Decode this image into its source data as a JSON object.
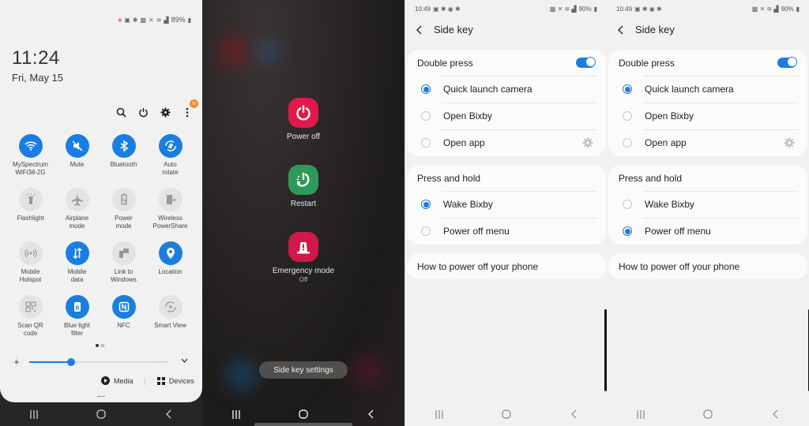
{
  "quick_panel": {
    "status": {
      "battery": "89%"
    },
    "clock": "11:24",
    "date": "Fri, May 15",
    "tools": [
      {
        "name": "search-icon"
      },
      {
        "name": "power-icon"
      },
      {
        "name": "settings-icon"
      },
      {
        "name": "more-icon",
        "badge": "N"
      }
    ],
    "tiles": [
      {
        "label": "MySpectrum\nWiFi38-2G",
        "icon": "wifi-icon",
        "on": true
      },
      {
        "label": "Mute",
        "icon": "mute-icon",
        "on": true
      },
      {
        "label": "Bluetooth",
        "icon": "bluetooth-icon",
        "on": true
      },
      {
        "label": "Auto\nrotate",
        "icon": "auto-rotate-icon",
        "on": true
      },
      {
        "label": "Flashlight",
        "icon": "flashlight-icon",
        "on": false
      },
      {
        "label": "Airplane\nmode",
        "icon": "airplane-icon",
        "on": false
      },
      {
        "label": "Power\nmode",
        "icon": "power-mode-icon",
        "on": false
      },
      {
        "label": "Wireless\nPowerShare",
        "icon": "wireless-powershare-icon",
        "on": false
      },
      {
        "label": "Mobile\nHotspot",
        "icon": "hotspot-icon",
        "on": false
      },
      {
        "label": "Mobile\ndata",
        "icon": "mobile-data-icon",
        "on": true
      },
      {
        "label": "Link to\nWindows",
        "icon": "link-to-windows-icon",
        "on": false
      },
      {
        "label": "Location",
        "icon": "location-icon",
        "on": true
      },
      {
        "label": "Scan QR\ncode",
        "icon": "qr-code-icon",
        "on": false
      },
      {
        "label": "Blue light\nfilter",
        "icon": "blue-light-icon",
        "on": true
      },
      {
        "label": "NFC",
        "icon": "nfc-icon",
        "on": true
      },
      {
        "label": "Smart View",
        "icon": "smart-view-icon",
        "on": false
      }
    ],
    "page_indicator": {
      "current": 1,
      "total": 2
    },
    "brightness_percent": 30,
    "media_label": "Media",
    "devices_label": "Devices"
  },
  "power_menu": {
    "items": [
      {
        "label": "Power off",
        "sub": "",
        "color": "#e0194a"
      },
      {
        "label": "Restart",
        "sub": "",
        "color": "#2e9a5a"
      },
      {
        "label": "Emergency mode",
        "sub": "Off",
        "color": "#d0184a"
      }
    ],
    "side_key_settings_label": "Side key settings"
  },
  "side_key_screens": [
    {
      "status": {
        "time": "10:49",
        "battery": "90%"
      },
      "title": "Side key",
      "double_press": {
        "label": "Double press",
        "enabled": true,
        "options": [
          "Quick launch camera",
          "Open Bixby",
          "Open app"
        ],
        "selected": 0
      },
      "press_and_hold": {
        "label": "Press and hold",
        "options": [
          "Wake Bixby",
          "Power off menu"
        ],
        "selected": 0
      },
      "how_to_label": "How to power off your phone"
    },
    {
      "status": {
        "time": "10:49",
        "battery": "90%"
      },
      "title": "Side key",
      "double_press": {
        "label": "Double press",
        "enabled": true,
        "options": [
          "Quick launch camera",
          "Open Bixby",
          "Open app"
        ],
        "selected": 0
      },
      "press_and_hold": {
        "label": "Press and hold",
        "options": [
          "Wake Bixby",
          "Power off menu"
        ],
        "selected": 1
      },
      "how_to_label": "How to power off your phone"
    }
  ],
  "colors": {
    "accent": "#1a7ee0",
    "panel_bg": "#f1f1f1",
    "card_bg": "#fbfbfb"
  }
}
